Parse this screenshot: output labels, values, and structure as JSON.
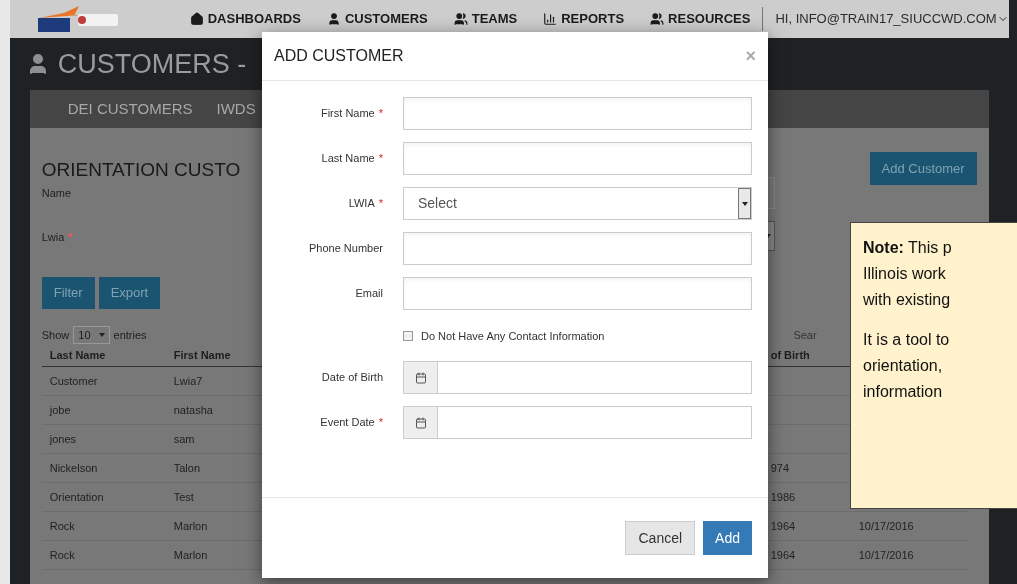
{
  "nav": {
    "items": [
      {
        "label": "DASHBOARDS",
        "kind": "home"
      },
      {
        "label": "CUSTOMERS",
        "kind": "user"
      },
      {
        "label": "TEAMS",
        "kind": "team"
      },
      {
        "label": "REPORTS",
        "kind": "chart"
      },
      {
        "label": "RESOURCES",
        "kind": "team"
      }
    ],
    "user": "HI, INFO@TRAIN17_SIUCCWD.COM"
  },
  "page_title": "CUSTOMERS -",
  "subnav": [
    "DEI CUSTOMERS",
    "IWDS"
  ],
  "section_title": "ORIENTATION CUSTO",
  "add_button": "Add Customer",
  "filters": [
    {
      "label": "Name"
    },
    {
      "label": "Lwia",
      "mark": "*"
    }
  ],
  "actions": [
    "Filter",
    "Export"
  ],
  "length": {
    "before": "Show",
    "value": "10",
    "after": "entries"
  },
  "search_label": "Sear",
  "table": {
    "columns": [
      "Last Name",
      "First Name",
      "",
      "of Birth",
      ""
    ],
    "rows": [
      [
        "Customer",
        "Lwia7",
        "",
        "",
        ""
      ],
      [
        "jobe",
        "natasha",
        "",
        "",
        ""
      ],
      [
        "jones",
        "sam",
        "",
        "",
        ""
      ],
      [
        "Nickelson",
        "Talon",
        "",
        "974",
        ""
      ],
      [
        "Orientation",
        "Test",
        "",
        "1986",
        ""
      ],
      [
        "Rock",
        "Marlon",
        "",
        "1964",
        "10/17/2016"
      ],
      [
        "Rock",
        "Marlon",
        "",
        "1964",
        "10/17/2016"
      ]
    ]
  },
  "modal": {
    "title": "ADD CUSTOMER",
    "close": "×",
    "fields": [
      {
        "kind": "text",
        "label": "First Name",
        "mark": "*"
      },
      {
        "kind": "text",
        "label": "Last Name",
        "mark": "*"
      },
      {
        "kind": "select",
        "label": "LWIA",
        "mark": "*",
        "placeholder": "Select"
      },
      {
        "kind": "text",
        "label": "Phone Number"
      },
      {
        "kind": "text",
        "label": "Email"
      },
      {
        "kind": "checkbox",
        "label": "Do Not Have Any Contact Information",
        "checked": false
      },
      {
        "kind": "date",
        "label": "Date of Birth"
      },
      {
        "kind": "date",
        "label": "Event Date",
        "mark": "*"
      }
    ],
    "buttons": [
      {
        "label": "Cancel",
        "primary": false
      },
      {
        "label": "Add",
        "primary": true
      }
    ]
  },
  "note": {
    "paragraphs": [
      [
        "**Note:**  This p",
        "Illinois work",
        "with existing"
      ],
      [
        "It is a tool to",
        "orientation,",
        "information"
      ]
    ]
  }
}
